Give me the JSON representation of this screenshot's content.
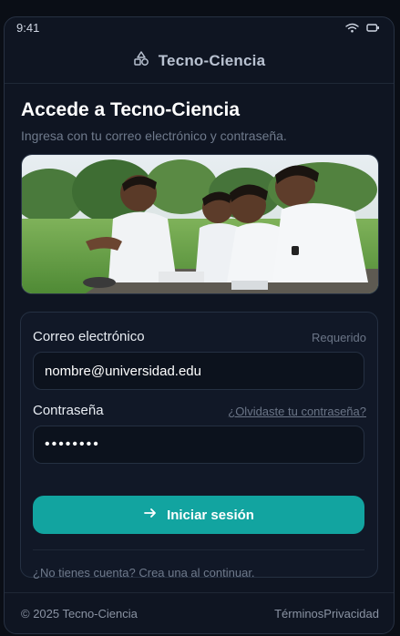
{
  "status_bar": {
    "time": "9:41"
  },
  "header": {
    "brand": "Tecno-Ciencia"
  },
  "main": {
    "title": "Accede a Tecno-Ciencia",
    "subtitle": "Ingresa con tu correo electrónico y contraseña."
  },
  "form": {
    "email_label": "Correo electrónico",
    "email_required": "Requerido",
    "email_value": "nombre@universidad.edu",
    "password_label": "Contraseña",
    "forgot_link": "¿Olvidaste tu contraseña?",
    "password_value": "••••••••",
    "submit_label": "Iniciar sesión",
    "signup_text": "¿No tienes cuenta? Crea una al continuar."
  },
  "footer": {
    "copyright": "© 2025 Tecno-Ciencia",
    "terms": "Términos",
    "privacy": "Privacidad"
  },
  "colors": {
    "accent": "#12a4a0",
    "background": "#0f1522",
    "card": "#111827"
  }
}
